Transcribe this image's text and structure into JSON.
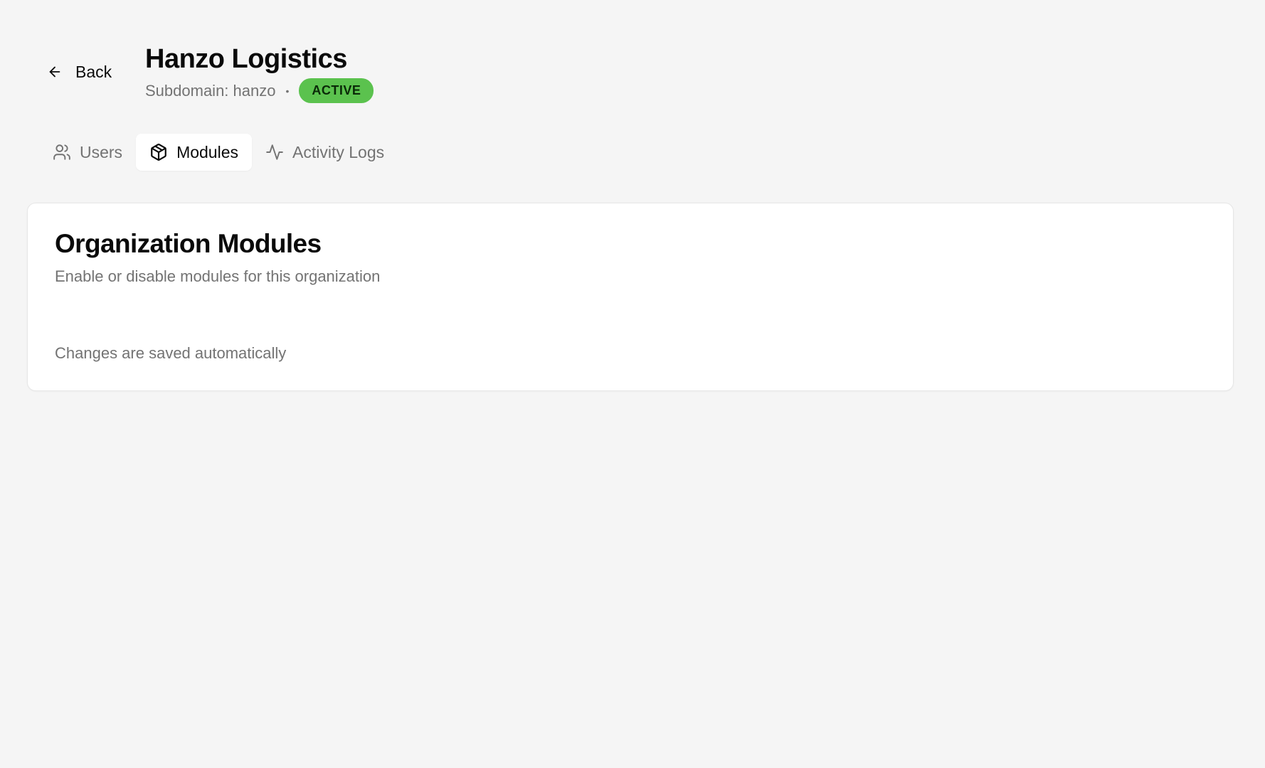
{
  "header": {
    "back_label": "Back",
    "title": "Hanzo Logistics",
    "subdomain_text": "Subdomain: hanzo",
    "separator": "•",
    "status": "ACTIVE",
    "status_color": "#5bc24e"
  },
  "tabs": [
    {
      "label": "Users",
      "icon": "users-icon",
      "active": false
    },
    {
      "label": "Modules",
      "icon": "package-icon",
      "active": true
    },
    {
      "label": "Activity Logs",
      "icon": "activity-icon",
      "active": false
    }
  ],
  "card": {
    "title": "Organization Modules",
    "description": "Enable or disable modules for this organization",
    "footer_note": "Changes are saved automatically"
  }
}
